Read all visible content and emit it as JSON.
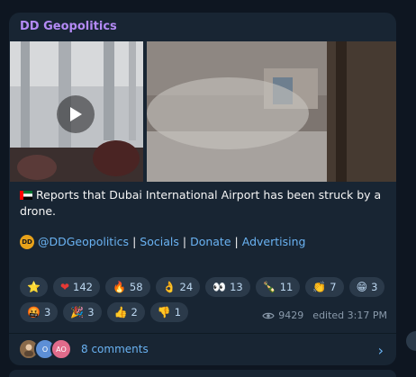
{
  "post": {
    "channel": "DD Geopolitics",
    "text": "Reports that Dubai International Airport has been struck by a drone.",
    "handle": "@DDGeopolitics",
    "logo_text": "DD",
    "links": [
      "Socials",
      "Donate",
      "Advertising"
    ],
    "separator": "|",
    "views": "9429",
    "edited": "edited 3:17 PM",
    "comments": "8 comments"
  },
  "reactions_row1": [
    {
      "emoji": "⭐",
      "count": ""
    },
    {
      "emoji": "❤",
      "count": "142"
    },
    {
      "emoji": "🔥",
      "count": "58"
    },
    {
      "emoji": "👌",
      "count": "24"
    },
    {
      "emoji": "👀",
      "count": "13"
    },
    {
      "emoji": "🍾",
      "count": "11"
    },
    {
      "emoji": "👏",
      "count": "7"
    },
    {
      "emoji": "😁",
      "count": "3"
    }
  ],
  "reactions_row2": [
    {
      "emoji": "🤬",
      "count": "3"
    },
    {
      "emoji": "🎉",
      "count": "3"
    },
    {
      "emoji": "👍",
      "count": "2"
    },
    {
      "emoji": "👎",
      "count": "1"
    }
  ],
  "avatars": [
    "",
    "O",
    "AO"
  ],
  "colors": {
    "accent": "#6ab3f3",
    "channel": "#b48af5",
    "bubble": "#182533"
  }
}
